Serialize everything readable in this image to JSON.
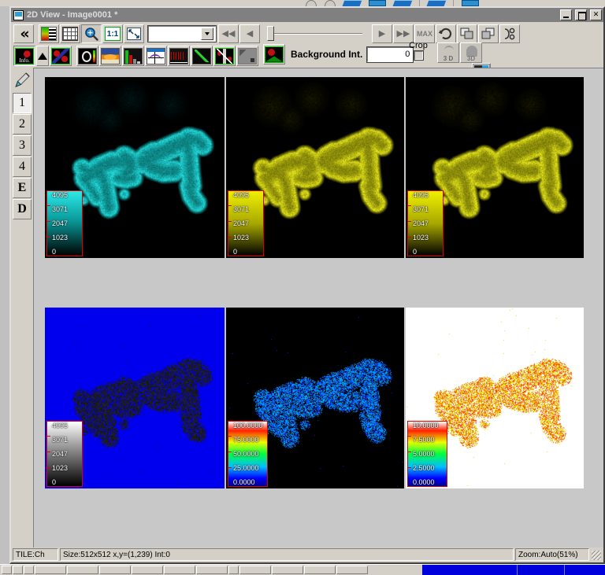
{
  "window": {
    "title": "2D View - Image0001 *",
    "icon": "window-document-icon",
    "minimize": "_",
    "maximize": "□",
    "close": "×"
  },
  "toolbar": {
    "collapse_label": "«",
    "buttons_row1": [
      {
        "name": "lut-bars",
        "tip": "LUT / Channel bars"
      },
      {
        "name": "grid",
        "tip": "Tile grid"
      },
      {
        "name": "zoom-magnifier",
        "tip": "Zoom"
      },
      {
        "name": "one-to-one",
        "label": "1:1",
        "tip": "Actual size"
      },
      {
        "name": "fit-to-window",
        "label": "✕",
        "tip": "Fit"
      }
    ],
    "zoom_combo": {
      "value": "",
      "placeholder": ""
    },
    "nav": {
      "rewind": "◀◀",
      "prev": "◀",
      "play": "▶",
      "fast_forward": "▶▶",
      "max_label": "MAX",
      "loop": "⟳",
      "tile1": "tile-front",
      "tile2": "tile-back",
      "chain": "split-channels"
    },
    "slider": {
      "value": 0,
      "min": 0,
      "max": 100
    },
    "background_intensity": {
      "label": "Background Int.",
      "value": "0"
    },
    "crop": {
      "label": "Crop",
      "checked": false
    },
    "view3d": {
      "label": "3 D"
    },
    "view3d_alt": {
      "label": "3D"
    }
  },
  "row2_buttons": [
    {
      "name": "info-button",
      "label": "Info."
    },
    {
      "name": "up-triangle-button",
      "label": "▲"
    },
    {
      "name": "channel-overlay-button",
      "label": ""
    },
    {
      "name": "circle-roi-button",
      "label": ""
    },
    {
      "name": "surface-plot-button",
      "label": ""
    },
    {
      "name": "histogram-button",
      "label": ""
    },
    {
      "name": "crosshair-profile-button",
      "label": ""
    },
    {
      "name": "line-profile-button",
      "label": ""
    },
    {
      "name": "scatter-plot-button",
      "label": ""
    },
    {
      "name": "ratio-button",
      "label": ""
    },
    {
      "name": "gradient-button",
      "label": ""
    }
  ],
  "left_bar": {
    "pencil": "pencil-tool",
    "items": [
      {
        "label": "1",
        "selected": true
      },
      {
        "label": "2",
        "selected": false
      },
      {
        "label": "3",
        "selected": false
      },
      {
        "label": "4",
        "selected": false
      },
      {
        "label": "E",
        "selected": false
      },
      {
        "label": "D",
        "selected": false
      }
    ]
  },
  "panels": [
    {
      "id": "panel-1",
      "name": "channel-1-cyan",
      "selected": true,
      "background": "#000000",
      "tint": "#22d8d8",
      "colorbar": {
        "type": "linear-cyan",
        "gradient_from": "#000000",
        "gradient_to": "#2ce8e8",
        "labels": [
          "4095",
          "3071",
          "2047",
          "1023",
          "0"
        ]
      }
    },
    {
      "id": "panel-2",
      "name": "channel-2-yellow",
      "selected": false,
      "background": "#000000",
      "tint": "#e8e82a",
      "colorbar": {
        "type": "linear-yellow",
        "gradient_from": "#000000",
        "gradient_to": "#f0f000",
        "labels": [
          "4095",
          "3071",
          "2047",
          "1023",
          "0"
        ]
      }
    },
    {
      "id": "panel-3",
      "name": "channel-merge-yellow",
      "selected": false,
      "background": "#000000",
      "tint": "#e8e82a",
      "colorbar": {
        "type": "linear-yellow",
        "gradient_from": "#000000",
        "gradient_to": "#f0f000",
        "labels": [
          "4095",
          "3071",
          "2047",
          "1023",
          "0"
        ]
      }
    },
    {
      "id": "panel-4",
      "name": "mask-overlay-blue",
      "selected": false,
      "background": "#0000ee",
      "tint": "#1a1a1a",
      "colorbar": {
        "type": "grayscale",
        "gradient_from": "#000000",
        "gradient_to": "#ffffff",
        "labels": [
          "4095",
          "3071",
          "2047",
          "1023",
          "0"
        ]
      }
    },
    {
      "id": "panel-5",
      "name": "intensity-map-rainbow-dark",
      "selected": false,
      "background": "#000000",
      "tint": "#2040ff",
      "colorbar": {
        "type": "rainbow",
        "labels": [
          "100.0000",
          "75.0000",
          "50.0000",
          "25.0000",
          "0.0000"
        ]
      }
    },
    {
      "id": "panel-6",
      "name": "intensity-map-rainbow-light",
      "selected": false,
      "background": "#ffffff",
      "tint": "#ff8000",
      "colorbar": {
        "type": "rainbow",
        "labels": [
          "10.0000",
          "7.5000",
          "5.0000",
          "2.5000",
          "0.0000"
        ]
      }
    }
  ],
  "status": {
    "tile": "TILE:Ch",
    "info": "Size:512x512 x,y=(1,239) Int:0",
    "zoom": "Zoom:Auto(51%)"
  }
}
